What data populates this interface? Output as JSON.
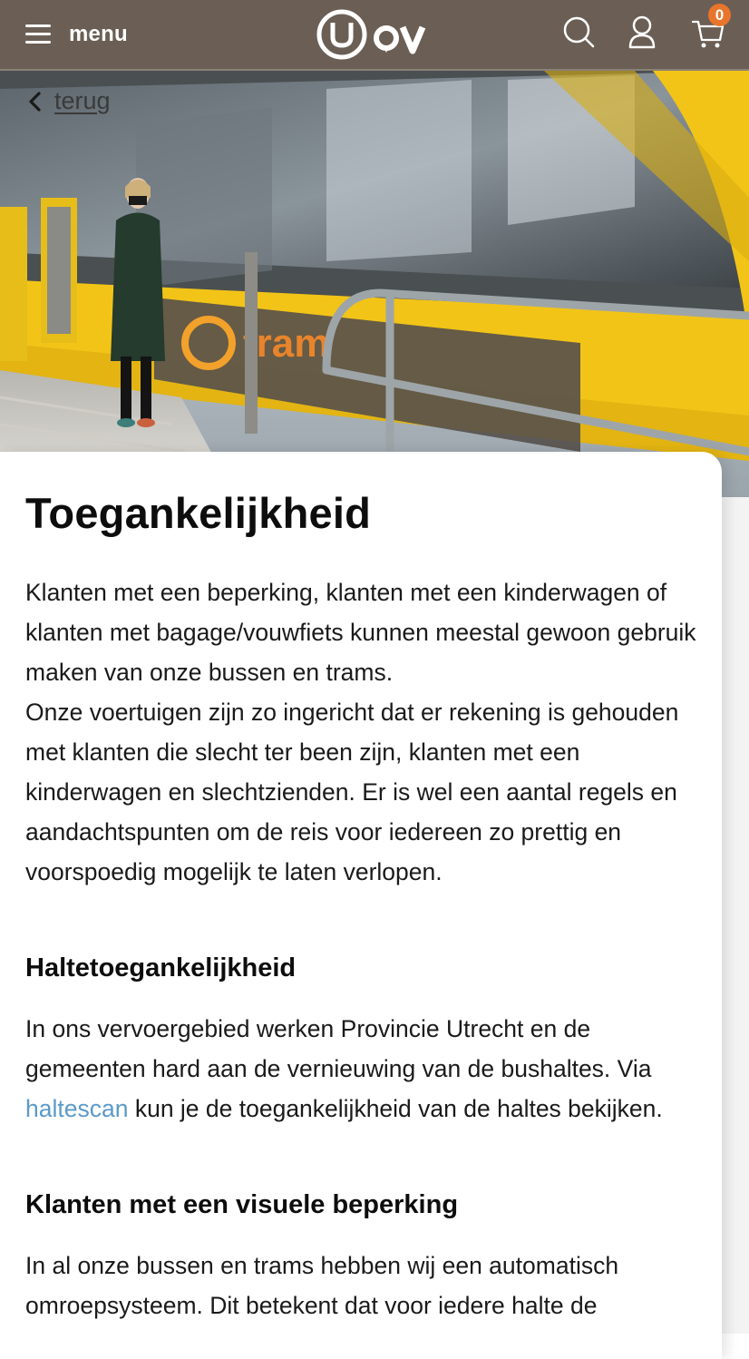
{
  "header": {
    "menu_label": "menu",
    "logo_icon": "u-ov-logo",
    "search_icon": "search-icon",
    "account_icon": "user-icon",
    "cart_icon": "cart-icon",
    "cart_count": "0",
    "colors": {
      "header_bg": "#6b5f55",
      "badge": "#e8752b",
      "link": "#5b9ac9",
      "tram_yellow": "#f2c418"
    }
  },
  "hero": {
    "back_label": "terug"
  },
  "content": {
    "title": "Toegankelijkheid",
    "intro_1": "Klanten met een beperking, klanten met een kinderwagen of klanten met bagage/vouwfiets kunnen meestal gewoon gebruik maken van onze bussen en trams.",
    "intro_2": "Onze voertuigen zijn zo ingericht dat er rekening is gehouden met klanten die slecht ter been zijn, klanten met een kinderwagen en slechtzienden. Er is wel een aantal regels en aandachtspunten om de reis voor iedereen zo prettig en voorspoedig mogelijk te laten verlopen.",
    "section_1_title": "Haltetoegankelijkheid",
    "section_1_text_a": "In ons vervoergebied werken Provincie Utrecht en de gemeenten hard aan de vernieuwing van de bushaltes. Via",
    "section_1_link": "haltescan",
    "section_1_text_b": "kun je de toegankelijkheid van de haltes bekijken.",
    "section_2_title": "Klanten met een visuele beperking",
    "section_2_text": "In al onze bussen en trams hebben wij een automatisch omroepsysteem. Dit betekent dat voor iedere halte de"
  }
}
